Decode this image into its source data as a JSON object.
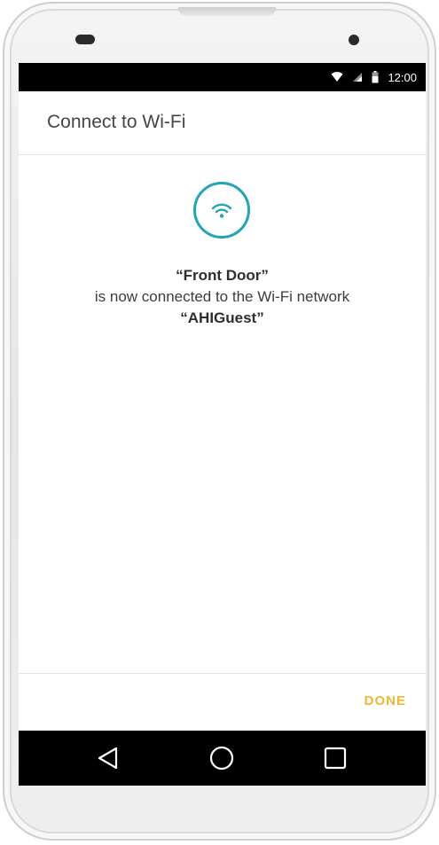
{
  "status_bar": {
    "time": "12:00",
    "icons": [
      "wifi-icon",
      "signal-icon",
      "battery-icon"
    ]
  },
  "header": {
    "title": "Connect to Wi-Fi"
  },
  "main": {
    "icon": "wifi-icon",
    "device_name": "“Front Door”",
    "message": "is now connected to the Wi-Fi network",
    "network_name": "“AHIGuest”"
  },
  "footer": {
    "done_label": "DONE"
  },
  "nav_bar": {
    "buttons": [
      "back-icon",
      "home-icon",
      "recent-apps-icon"
    ]
  },
  "colors": {
    "accent_teal": "#25a5b3",
    "done_yellow": "#f2b632",
    "bar_black": "#000000"
  }
}
